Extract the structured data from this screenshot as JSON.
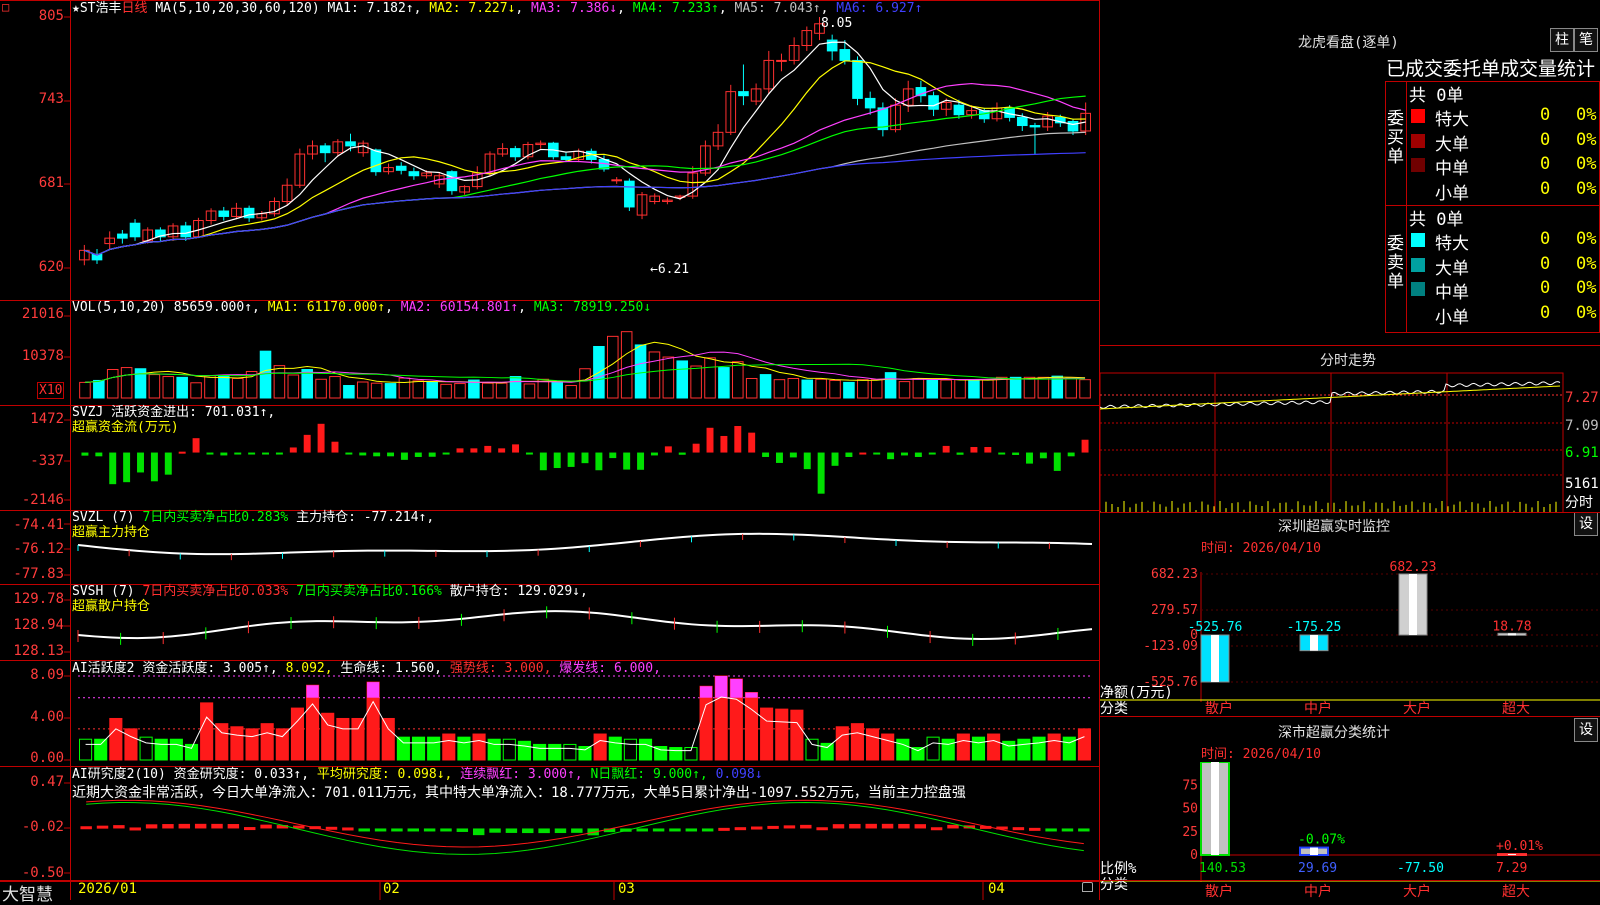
{
  "colors": {
    "up": "#ff3030",
    "down": "#00ffff",
    "grid": "#c00000",
    "bg": "#000000",
    "ma1": "#ffffff",
    "ma2": "#ffff00",
    "ma3": "#ff40ff",
    "ma4": "#00ff00",
    "ma5": "#c0c0c0",
    "ma6": "#4040ff"
  },
  "header": {
    "star": "★",
    "stock": "ST浩丰",
    "period": "日线",
    "ma_params": "MA(5,10,20,30,60,120)",
    "ma1": "MA1: 7.182↑",
    "ma2": "MA2: 7.227↓",
    "ma3": "MA3: 7.386↓",
    "ma4": "MA4: 7.233↑",
    "ma5": "MA5: 7.043↑",
    "ma6": "MA6: 6.927↑",
    "corner_box": "□"
  },
  "price": {
    "axis": [
      "805",
      "743",
      "681",
      "620"
    ],
    "high_label": "8.05",
    "low_label": "←6.21"
  },
  "vol": {
    "label": "VOL(5,10,20)",
    "value": "85659.000↑",
    "ma1": "MA1: 61170.000↑",
    "ma2": "MA2: 60154.801↑",
    "ma3": "MA3: 78919.250↓",
    "axis": [
      "21016",
      "10378"
    ],
    "unit": "X10"
  },
  "svzj": {
    "label": "SVZJ",
    "text": "活跃资金进出: 701.031↑,",
    "sub": "超赢资金流(万元)",
    "axis": [
      "1472",
      "-337",
      "-2146"
    ]
  },
  "svzl": {
    "label": "SVZL (7)",
    "text1": "7日内买卖净占比0.283%",
    "text2": "主力持仓: -77.214↑,",
    "sub": "超赢主力持仓",
    "axis": [
      "-74.41",
      "-76.12",
      "-77.83"
    ]
  },
  "svsh": {
    "label": "SVSH (7)",
    "text1": "7日内买卖净占比0.033%",
    "text2": "7日内买卖净占比0.166%",
    "text3": "散户持仓: 129.029↓,",
    "sub": "超赢散户持仓",
    "axis": [
      "129.78",
      "128.94",
      "128.13"
    ]
  },
  "ai1": {
    "label": "AI活跃度2",
    "t1": "资金活跃度: 3.005↑,",
    "t2": "8.092,",
    "t3": "生命线: 1.560,",
    "t4": "强势线: 3.000,",
    "t5": "爆发线: 6.000,",
    "axis": [
      "8.09",
      "4.00",
      "0.00"
    ]
  },
  "ai2": {
    "label": "AI研究度2(10)",
    "t1": "资金研究度: 0.033↑,",
    "t2": "平均研究度: 0.098↓,",
    "t3": "连续飘红: 3.000↑,",
    "t4": "N日飘红: 9.000↑,",
    "t5": "0.098↓",
    "comment": "近期大资金非常活跃，今日大单净流入：701.011万元，其中特大单净流入：18.777万元，大单5日累计净出-1097.552万元，当前主力控盘强",
    "axis": [
      "0.47",
      "-0.02",
      "-0.50"
    ]
  },
  "xaxis": {
    "logo": "大智慧",
    "labels": [
      "2026/01",
      "02",
      "03",
      "04"
    ]
  },
  "longhu": {
    "title": "龙虎看盘(逐单)",
    "btn1": "柱",
    "btn2": "笔",
    "subtitle": "已成交委托单成交量统计",
    "buy_label": "委买单",
    "sell_label": "委卖单",
    "buy_total": "共 0单",
    "sell_total": "共 0单",
    "buy_rows": [
      {
        "name": "特大",
        "val": "0",
        "pct": "0%",
        "color": "#ff0000"
      },
      {
        "name": "大单",
        "val": "0",
        "pct": "0%",
        "color": "#a00000"
      },
      {
        "name": "中单",
        "val": "0",
        "pct": "0%",
        "color": "#700000"
      },
      {
        "name": "小单",
        "val": "0",
        "pct": "0%",
        "color": "#000000"
      }
    ],
    "sell_rows": [
      {
        "name": "特大",
        "val": "0",
        "pct": "0%",
        "color": "#00ffff"
      },
      {
        "name": "大单",
        "val": "0",
        "pct": "0%",
        "color": "#00a0a0"
      },
      {
        "name": "中单",
        "val": "0",
        "pct": "0%",
        "color": "#008080"
      },
      {
        "name": "小单",
        "val": "0",
        "pct": "0%",
        "color": "#000000"
      }
    ]
  },
  "fenshi": {
    "title": "分时走势",
    "axis": [
      "7.27",
      "7.09",
      "6.91"
    ],
    "vol": "5161",
    "vol_unit": "分时"
  },
  "monitor": {
    "title": "深圳超赢实时监控",
    "btn": "设",
    "time": "时间: 2026/04/10",
    "axis": [
      "682.23",
      "279.57",
      "0",
      "-123.09",
      "-525.76"
    ],
    "ylabel": "净额(万元)",
    "xlabel": "分类",
    "bars": [
      {
        "name": "散户",
        "value": -525.76
      },
      {
        "name": "中户",
        "value": -175.25
      },
      {
        "name": "大户",
        "value": 682.23
      },
      {
        "name": "超大",
        "value": 18.78
      }
    ]
  },
  "category": {
    "title": "深市超赢分类统计",
    "btn": "设",
    "time": "时间: 2026/04/10",
    "axis": [
      "75",
      "50",
      "25",
      "0"
    ],
    "ylabel": "比例%",
    "xlabel": "分类",
    "bars": [
      {
        "name": "散户",
        "value": 140.53,
        "pct": null
      },
      {
        "name": "中户",
        "value": 29.69,
        "pct": "-0.07%"
      },
      {
        "name": "大户",
        "value": -77.5,
        "pct": null
      },
      {
        "name": "超大",
        "value": 7.29,
        "pct": "+0.01%"
      }
    ]
  },
  "chart_data": [
    {
      "type": "candlestick",
      "title": "ST浩丰 日线",
      "ylim": [
        6.2,
        8.05
      ],
      "candles": [
        [
          6.26,
          6.33,
          6.22,
          6.37
        ],
        [
          6.3,
          6.26,
          6.23,
          6.34
        ],
        [
          6.38,
          6.42,
          6.34,
          6.47
        ],
        [
          6.45,
          6.42,
          6.38,
          6.48
        ],
        [
          6.53,
          6.43,
          6.4,
          6.56
        ],
        [
          6.4,
          6.48,
          6.38,
          6.5
        ],
        [
          6.48,
          6.43,
          6.39,
          6.5
        ],
        [
          6.43,
          6.51,
          6.4,
          6.53
        ],
        [
          6.51,
          6.43,
          6.4,
          6.54
        ],
        [
          6.43,
          6.55,
          6.42,
          6.57
        ],
        [
          6.55,
          6.62,
          6.52,
          6.64
        ],
        [
          6.62,
          6.58,
          6.55,
          6.65
        ],
        [
          6.58,
          6.64,
          6.56,
          6.68
        ],
        [
          6.64,
          6.57,
          6.54,
          6.66
        ],
        [
          6.57,
          6.6,
          6.55,
          6.62
        ],
        [
          6.6,
          6.69,
          6.58,
          6.72
        ],
        [
          6.69,
          6.81,
          6.66,
          6.86
        ],
        [
          6.81,
          7.04,
          6.79,
          7.08
        ],
        [
          7.04,
          7.1,
          7.0,
          7.14
        ],
        [
          7.1,
          7.05,
          6.98,
          7.12
        ],
        [
          7.05,
          7.13,
          7.02,
          7.15
        ],
        [
          7.13,
          7.1,
          7.06,
          7.19
        ],
        [
          7.05,
          7.12,
          7.02,
          7.14
        ],
        [
          7.07,
          6.91,
          6.88,
          7.08
        ],
        [
          6.91,
          6.94,
          6.89,
          6.97
        ],
        [
          6.95,
          6.92,
          6.89,
          6.98
        ],
        [
          6.91,
          6.88,
          6.85,
          6.94
        ],
        [
          6.88,
          6.9,
          6.86,
          6.92
        ],
        [
          6.82,
          6.88,
          6.79,
          6.9
        ],
        [
          6.91,
          6.77,
          6.74,
          6.92
        ],
        [
          6.76,
          6.8,
          6.74,
          6.81
        ],
        [
          6.8,
          6.9,
          6.78,
          6.95
        ],
        [
          6.9,
          7.04,
          6.88,
          7.06
        ],
        [
          7.04,
          7.08,
          7.02,
          7.12
        ],
        [
          7.08,
          7.02,
          6.99,
          7.1
        ],
        [
          7.02,
          7.11,
          7.0,
          7.13
        ],
        [
          7.11,
          7.12,
          7.08,
          7.14
        ],
        [
          7.12,
          7.02,
          7.0,
          7.13
        ],
        [
          7.02,
          7.0,
          6.98,
          7.05
        ],
        [
          7.0,
          7.06,
          6.98,
          7.08
        ],
        [
          7.06,
          7.0,
          6.97,
          7.08
        ],
        [
          7.0,
          6.93,
          6.91,
          7.03
        ],
        [
          6.85,
          6.85,
          6.82,
          6.87
        ],
        [
          6.84,
          6.65,
          6.62,
          6.86
        ],
        [
          6.59,
          6.74,
          6.56,
          6.76
        ],
        [
          6.69,
          6.73,
          6.67,
          6.75
        ],
        [
          6.69,
          6.7,
          6.67,
          6.72
        ],
        [
          6.72,
          6.73,
          6.7,
          6.74
        ],
        [
          6.73,
          6.9,
          6.71,
          6.95
        ],
        [
          6.9,
          7.1,
          6.88,
          7.14
        ],
        [
          7.1,
          7.2,
          7.07,
          7.26
        ],
        [
          7.2,
          7.5,
          7.18,
          7.55
        ],
        [
          7.5,
          7.47,
          7.4,
          7.7
        ],
        [
          7.43,
          7.52,
          7.4,
          7.56
        ],
        [
          7.52,
          7.73,
          7.48,
          7.8
        ],
        [
          7.73,
          7.73,
          7.65,
          7.78
        ],
        [
          7.73,
          7.84,
          7.7,
          7.9
        ],
        [
          7.84,
          7.95,
          7.8,
          7.98
        ],
        [
          7.93,
          8.0,
          7.88,
          8.05
        ],
        [
          7.88,
          7.8,
          7.73,
          7.92
        ],
        [
          7.81,
          7.73,
          7.7,
          7.88
        ],
        [
          7.73,
          7.45,
          7.4,
          7.76
        ],
        [
          7.45,
          7.38,
          7.33,
          7.5
        ],
        [
          7.38,
          7.22,
          7.17,
          7.42
        ],
        [
          7.22,
          7.4,
          7.2,
          7.45
        ],
        [
          7.4,
          7.52,
          7.35,
          7.58
        ],
        [
          7.53,
          7.47,
          7.42,
          7.58
        ],
        [
          7.47,
          7.37,
          7.32,
          7.5
        ],
        [
          7.37,
          7.42,
          7.32,
          7.45
        ],
        [
          7.4,
          7.33,
          7.3,
          7.44
        ],
        [
          7.33,
          7.36,
          7.3,
          7.4
        ],
        [
          7.36,
          7.3,
          7.27,
          7.38
        ],
        [
          7.3,
          7.38,
          7.28,
          7.42
        ],
        [
          7.38,
          7.31,
          7.28,
          7.4
        ],
        [
          7.31,
          7.25,
          7.21,
          7.34
        ],
        [
          7.25,
          7.24,
          7.04,
          7.27
        ],
        [
          7.24,
          7.32,
          7.21,
          7.35
        ],
        [
          7.31,
          7.27,
          7.24,
          7.33
        ],
        [
          7.28,
          7.21,
          7.18,
          7.3
        ],
        [
          7.21,
          7.34,
          7.18,
          7.42
        ]
      ]
    },
    {
      "type": "bar",
      "title": "VOL(5,10,20)",
      "ylim": [
        0,
        22000
      ],
      "values": [
        4000,
        4500,
        7300,
        7800,
        7500,
        6000,
        5500,
        5300,
        3900,
        5700,
        5800,
        5000,
        6800,
        12000,
        8300,
        5900,
        7300,
        4800,
        5500,
        3200,
        4100,
        3800,
        3700,
        5100,
        4400,
        4100,
        3500,
        3700,
        4600,
        3800,
        3800,
        5500,
        3600,
        4800,
        4000,
        3200,
        7500,
        13200,
        15800,
        17000,
        13600,
        11800,
        10500,
        9500,
        8200,
        10300,
        7800,
        9300,
        5000,
        6000,
        4700,
        5000,
        4600,
        4800,
        4500,
        4000,
        4700,
        4700,
        6500,
        4200,
        5000,
        4500,
        4600,
        4700,
        4500,
        4600,
        5300,
        5300,
        5300,
        5300,
        5600,
        5100,
        4700
      ]
    },
    {
      "type": "bar",
      "title": "SVZJ 活跃资金进出",
      "ylim": [
        -2146,
        1472
      ],
      "values": [
        -140,
        -170,
        -1430,
        -1340,
        -900,
        -1300,
        -1000,
        40,
        650,
        -90,
        -130,
        -60,
        -40,
        -80,
        -90,
        230,
        800,
        1300,
        490,
        -20,
        -130,
        -170,
        -170,
        -330,
        -200,
        -190,
        -50,
        190,
        190,
        300,
        190,
        370,
        -40,
        -800,
        -700,
        -650,
        -480,
        -800,
        -250,
        -770,
        -780,
        -130,
        280,
        -100,
        400,
        1120,
        750,
        1200,
        900,
        -200,
        -470,
        -220,
        -750,
        -1860,
        -600,
        -200,
        0,
        -90,
        -300,
        -130,
        -200,
        -90,
        300,
        -100,
        250,
        250,
        -60,
        -110,
        -500,
        -260,
        -830,
        -170,
        580
      ]
    },
    {
      "type": "bar",
      "title": "AI活跃度2",
      "ylim": [
        0,
        8.09
      ],
      "values": [
        2.0,
        2.0,
        4.0,
        3.0,
        2.2,
        2.0,
        2.0,
        1.5,
        5.5,
        3.5,
        3.2,
        3.0,
        3.5,
        3.0,
        5.0,
        7.2,
        4.5,
        4.0,
        4.0,
        7.5,
        4.0,
        2.2,
        2.2,
        2.2,
        2.5,
        2.2,
        2.5,
        2.0,
        2.0,
        1.8,
        1.5,
        1.5,
        1.5,
        1.3,
        2.5,
        2.2,
        2.0,
        2.0,
        1.3,
        1.2,
        1.2,
        7.1,
        8.09,
        7.8,
        6.5,
        5.0,
        4.9,
        4.8,
        2.0,
        1.6,
        3.2,
        3.5,
        3.0,
        2.5,
        2.0,
        1.2,
        2.2,
        2.0,
        2.5,
        2.2,
        2.5,
        1.8,
        2.0,
        2.2,
        2.5,
        2.2,
        3.0
      ]
    },
    {
      "type": "bar",
      "title": "深圳超赢实时监控",
      "categories": [
        "散户",
        "中户",
        "大户",
        "超大"
      ],
      "values": [
        -525.76,
        -175.25,
        682.23,
        18.78
      ],
      "ylabel": "净额(万元)",
      "ylim": [
        -525.76,
        682.23
      ]
    },
    {
      "type": "bar",
      "title": "深市超赢分类统计",
      "categories": [
        "散户",
        "中户",
        "大户",
        "超大"
      ],
      "values": [
        140.53,
        29.69,
        -77.5,
        7.29
      ],
      "ylabel": "比例%"
    }
  ]
}
